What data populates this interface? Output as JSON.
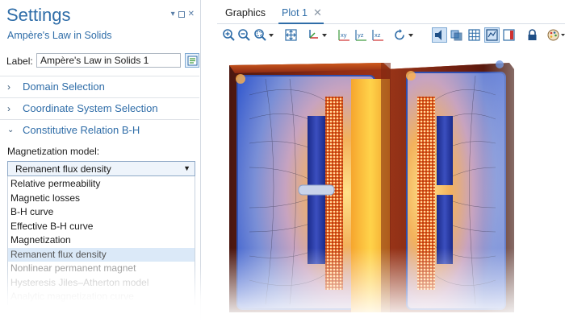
{
  "settings": {
    "title": "Settings",
    "subtitle": "Ampère's Law in Solids",
    "label_caption": "Label:",
    "label_value": "Ampère's Law in Solids 1",
    "sections": [
      {
        "label": "Domain Selection",
        "expanded": false
      },
      {
        "label": "Coordinate System Selection",
        "expanded": false
      },
      {
        "label": "Constitutive Relation B-H",
        "expanded": true
      }
    ],
    "magnetization": {
      "caption": "Magnetization model:",
      "selected": "Remanent flux density",
      "options": [
        "Relative permeability",
        "Magnetic losses",
        "B-H curve",
        "Effective B-H curve",
        "Magnetization",
        "Remanent flux density",
        "Nonlinear permanent magnet",
        "Hysteresis Jiles–Atherton model",
        "Analytic magnetization curve"
      ]
    }
  },
  "graphics": {
    "tabs": [
      {
        "label": "Graphics",
        "active": false
      },
      {
        "label": "Plot 1",
        "active": true
      }
    ],
    "close_glyph": "✕",
    "toolbar_icons": [
      "zoom-in-icon",
      "zoom-out-icon",
      "zoom-box-icon",
      "zoom-extents-icon",
      "axis-orientation-icon",
      "view-xy-icon",
      "view-yz-icon",
      "view-xz-icon",
      "rotate-icon",
      "scene-light-icon",
      "transparency-icon",
      "grid-icon",
      "wireframe-icon",
      "render-icon",
      "lock-icon",
      "palette-icon"
    ],
    "toolbar_labels": {
      "xy": "xy",
      "yz": "yz",
      "xz": "xz"
    }
  },
  "colors": {
    "accent": "#2f6da8",
    "selected_bg": "#dbe9f8"
  }
}
